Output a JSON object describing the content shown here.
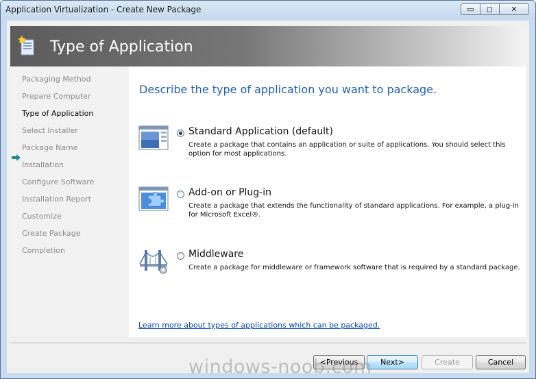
{
  "window": {
    "title": "Application Virtualization - Create New Package",
    "controls": {
      "minimize": "▭",
      "maximize": "◻",
      "close": "✕"
    }
  },
  "banner": {
    "title": "Type of Application",
    "icon": "wizard-package-icon"
  },
  "sidebar": {
    "current_index": 2,
    "steps": [
      "Packaging Method",
      "Prepare Computer",
      "Type of Application",
      "Select Installer",
      "Package Name",
      "Installation",
      "Configure Software",
      "Installation Report",
      "Customize",
      "Create Package",
      "Completion"
    ]
  },
  "main": {
    "heading": "Describe the type of application you want to package.",
    "options": [
      {
        "title": "Standard Application (default)",
        "description": "Create a package that contains an application or suite of applications. You should select this option for most applications.",
        "selected": true,
        "icon": "window-icon"
      },
      {
        "title": "Add-on or Plug-in",
        "description": "Create a package that extends the functionality of standard applications. For example, a plug-in for Microsoft Excel®.",
        "selected": false,
        "icon": "puzzle-piece-icon"
      },
      {
        "title": "Middleware",
        "description": "Create a package for middleware or framework software that is required by a standard package.",
        "selected": false,
        "icon": "bridge-gear-icon"
      }
    ],
    "learn_more_link": "Learn more about types of applications which can be packaged."
  },
  "footer": {
    "previous": "<Previous",
    "next": "Next>",
    "create": "Create",
    "cancel": "Cancel"
  },
  "watermark": "windows-noob.com",
  "colors": {
    "heading": "#1f5fa8",
    "link": "#0645ad",
    "window_frame": "#c9dbef"
  }
}
